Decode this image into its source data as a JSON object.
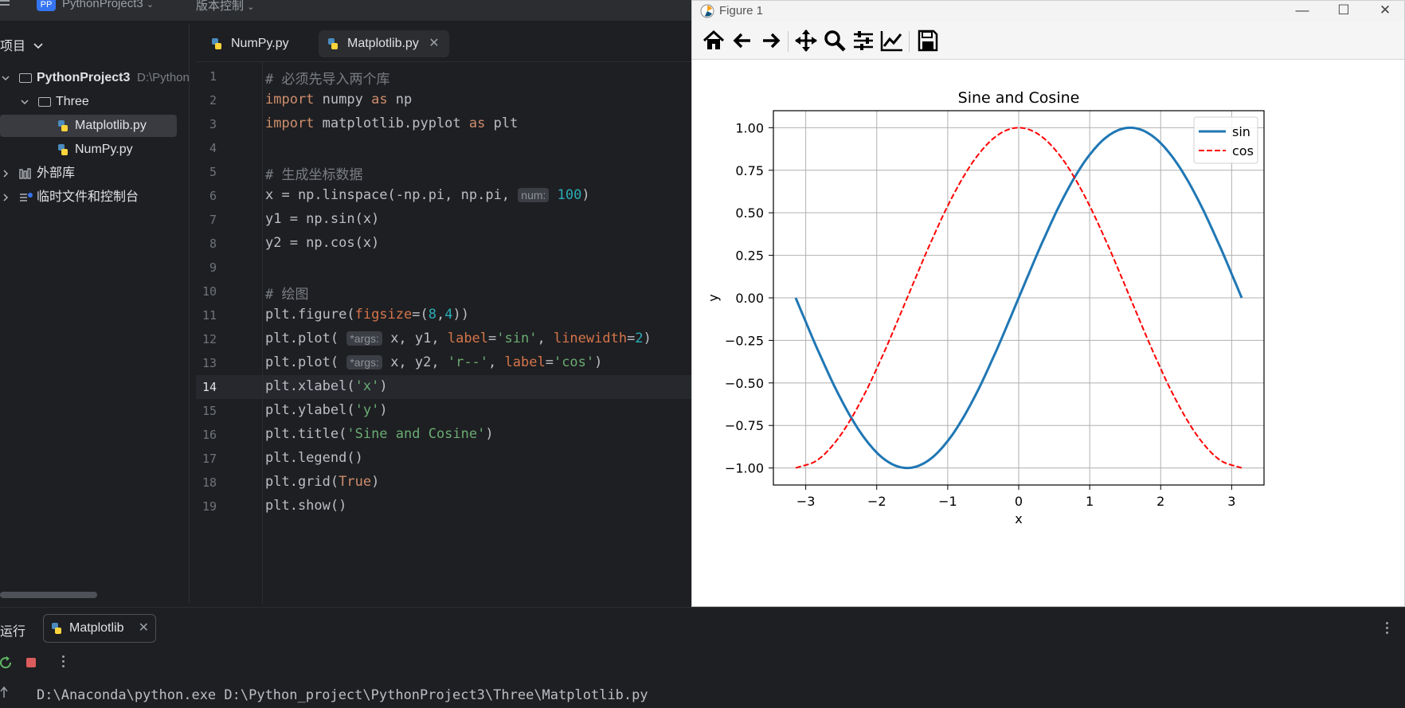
{
  "topbar": {
    "project_badge": "PP",
    "project_name": "PythonProject3",
    "vcs_label": "版本控制"
  },
  "project_panel": {
    "header": "项目",
    "tree": [
      {
        "label": "PythonProject3",
        "hint": "D:\\Python"
      },
      {
        "label": "Three"
      },
      {
        "label": "Matplotlib.py",
        "selected": true
      },
      {
        "label": "NumPy.py"
      },
      {
        "label": "外部库"
      },
      {
        "label": "临时文件和控制台"
      }
    ]
  },
  "editor": {
    "tabs": [
      {
        "label": "NumPy.py"
      },
      {
        "label": "Matplotlib.py",
        "active": true
      }
    ],
    "current_line": 14,
    "line_numbers": [
      "1",
      "2",
      "3",
      "4",
      "5",
      "6",
      "7",
      "8",
      "9",
      "10",
      "11",
      "12",
      "13",
      "14",
      "15",
      "16",
      "17",
      "18",
      "19"
    ],
    "code": [
      [
        {
          "t": "# 必须先导入两个库",
          "c": "cmt"
        }
      ],
      [
        {
          "t": "import",
          "c": "kw"
        },
        {
          "t": " numpy "
        },
        {
          "t": "as",
          "c": "kw"
        },
        {
          "t": " np"
        }
      ],
      [
        {
          "t": "import",
          "c": "kw"
        },
        {
          "t": " matplotlib.pyplot "
        },
        {
          "t": "as",
          "c": "kw"
        },
        {
          "t": " plt"
        }
      ],
      [],
      [
        {
          "t": "# 生成坐标数据",
          "c": "cmt"
        }
      ],
      [
        {
          "t": "x = np.linspace(-np.pi, np.pi, "
        },
        {
          "t": "num:",
          "c": "hint"
        },
        {
          "t": "100",
          "c": "num"
        },
        {
          "t": ")"
        }
      ],
      [
        {
          "t": "y1 = np.sin(x)"
        }
      ],
      [
        {
          "t": "y2 = np.cos(x)"
        }
      ],
      [],
      [
        {
          "t": "# 绘图",
          "c": "cmt"
        }
      ],
      [
        {
          "t": "plt.figure("
        },
        {
          "t": "figsize",
          "c": "param"
        },
        {
          "t": "=("
        },
        {
          "t": "8",
          "c": "num"
        },
        {
          "t": ","
        },
        {
          "t": "4",
          "c": "num"
        },
        {
          "t": "))"
        }
      ],
      [
        {
          "t": "plt.plot( "
        },
        {
          "t": "*args:",
          "c": "hint"
        },
        {
          "t": "x, y1, "
        },
        {
          "t": "label",
          "c": "param"
        },
        {
          "t": "="
        },
        {
          "t": "'sin'",
          "c": "str"
        },
        {
          "t": ", "
        },
        {
          "t": "linewidth",
          "c": "param"
        },
        {
          "t": "="
        },
        {
          "t": "2",
          "c": "num"
        },
        {
          "t": ")"
        }
      ],
      [
        {
          "t": "plt.plot( "
        },
        {
          "t": "*args:",
          "c": "hint"
        },
        {
          "t": "x, y2, "
        },
        {
          "t": "'r--'",
          "c": "str"
        },
        {
          "t": ", "
        },
        {
          "t": "label",
          "c": "param"
        },
        {
          "t": "="
        },
        {
          "t": "'cos'",
          "c": "str"
        },
        {
          "t": ")"
        }
      ],
      [
        {
          "t": "plt.xlabel("
        },
        {
          "t": "'x'",
          "c": "str"
        },
        {
          "t": ")"
        }
      ],
      [
        {
          "t": "plt.ylabel("
        },
        {
          "t": "'y'",
          "c": "str"
        },
        {
          "t": ")"
        }
      ],
      [
        {
          "t": "plt.title("
        },
        {
          "t": "'Sine and Cosine'",
          "c": "str"
        },
        {
          "t": ")"
        }
      ],
      [
        {
          "t": "plt.legend()"
        }
      ],
      [
        {
          "t": "plt.grid("
        },
        {
          "t": "True",
          "c": "kw"
        },
        {
          "t": ")"
        }
      ],
      [
        {
          "t": "plt.show()"
        }
      ]
    ]
  },
  "figure_window": {
    "title": "Figure 1",
    "toolbar_icons": [
      "home-icon",
      "back-arrow-icon",
      "forward-arrow-icon",
      "pan-icon",
      "zoom-icon",
      "configure-subplots-icon",
      "edit-axis-icon",
      "save-icon"
    ]
  },
  "chart_data": {
    "type": "line",
    "title": "Sine and Cosine",
    "xlabel": "x",
    "ylabel": "y",
    "xlim": [
      -3.4558,
      3.4558
    ],
    "ylim": [
      -1.1,
      1.1
    ],
    "xticks": [
      -3,
      -2,
      -1,
      0,
      1,
      2,
      3
    ],
    "xtick_labels": [
      "−3",
      "−2",
      "−1",
      "0",
      "1",
      "2",
      "3"
    ],
    "yticks": [
      -1.0,
      -0.75,
      -0.5,
      -0.25,
      0.0,
      0.25,
      0.5,
      0.75,
      1.0
    ],
    "ytick_labels": [
      "−1.00",
      "−0.75",
      "−0.50",
      "−0.25",
      "0.00",
      "0.25",
      "0.50",
      "0.75",
      "1.00"
    ],
    "grid": true,
    "legend_position": "top-right",
    "series": [
      {
        "name": "sin",
        "color": "#1f77b4",
        "style": "solid",
        "x": [
          -3.1416,
          -2.8274,
          -2.5133,
          -2.1991,
          -1.885,
          -1.5708,
          -1.2566,
          -0.9425,
          -0.6283,
          -0.3142,
          0.0,
          0.3142,
          0.6283,
          0.9425,
          1.2566,
          1.5708,
          1.885,
          2.1991,
          2.5133,
          2.8274,
          3.1416
        ],
        "y": [
          0.0,
          -0.309,
          -0.5878,
          -0.809,
          -0.9511,
          -1.0,
          -0.9511,
          -0.809,
          -0.5878,
          -0.309,
          0.0,
          0.309,
          0.5878,
          0.809,
          0.9511,
          1.0,
          0.9511,
          0.809,
          0.5878,
          0.309,
          0.0
        ]
      },
      {
        "name": "cos",
        "color": "#ff0000",
        "style": "dashed",
        "x": [
          -3.1416,
          -2.8274,
          -2.5133,
          -2.1991,
          -1.885,
          -1.5708,
          -1.2566,
          -0.9425,
          -0.6283,
          -0.3142,
          0.0,
          0.3142,
          0.6283,
          0.9425,
          1.2566,
          1.5708,
          1.885,
          2.1991,
          2.5133,
          2.8274,
          3.1416
        ],
        "y": [
          -1.0,
          -0.9511,
          -0.809,
          -0.5878,
          -0.309,
          0.0,
          0.309,
          0.5878,
          0.809,
          0.9511,
          1.0,
          0.9511,
          0.809,
          0.5878,
          0.309,
          0.0,
          -0.309,
          -0.5878,
          -0.809,
          -0.9511,
          -1.0
        ]
      }
    ]
  },
  "run_panel": {
    "label": "运行",
    "tab_label": "Matplotlib",
    "console_output": "D:\\Anaconda\\python.exe D:\\Python_project\\PythonProject3\\Three\\Matplotlib.py"
  },
  "colors": {
    "ide_bg": "#1e1f22",
    "panel_bg": "#2b2d30",
    "selection": "#393b40",
    "accent": "#3574f0"
  }
}
